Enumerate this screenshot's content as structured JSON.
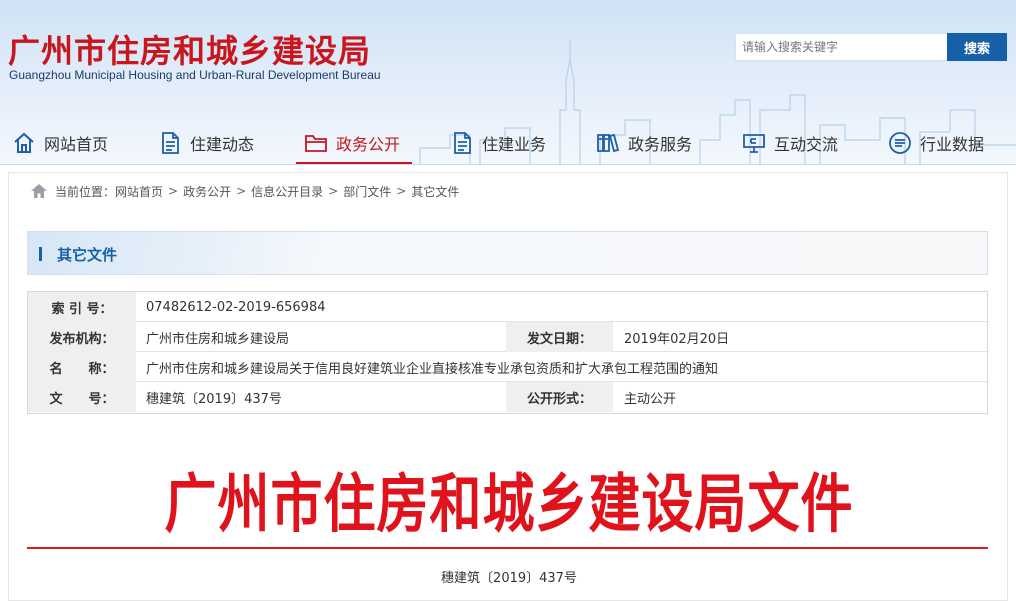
{
  "header": {
    "title": "广州市住房和城乡建设局",
    "subtitle": "Guangzhou Municipal Housing and Urban-Rural Development Bureau",
    "search": {
      "placeholder": "请输入搜索关键字",
      "button_label": "搜索"
    }
  },
  "nav": {
    "items": [
      {
        "label": "网站首页",
        "icon": "home-icon"
      },
      {
        "label": "住建动态",
        "icon": "document-icon"
      },
      {
        "label": "政务公开",
        "icon": "folder-icon",
        "active": true
      },
      {
        "label": "住建业务",
        "icon": "document-icon"
      },
      {
        "label": "政务服务",
        "icon": "books-icon"
      },
      {
        "label": "互动交流",
        "icon": "monitor-icon"
      },
      {
        "label": "行业数据",
        "icon": "chat-icon"
      }
    ]
  },
  "breadcrumb": {
    "prefix": "当前位置：",
    "items": [
      "网站首页",
      "政务公开",
      "信息公开目录",
      "部门文件",
      "其它文件"
    ],
    "separator": ">"
  },
  "section": {
    "title": "其它文件"
  },
  "meta": {
    "index_label": "索 引 号：",
    "index_value": "07482612-02-2019-656984",
    "publisher_label": "发布机构：",
    "publisher_value": "广州市住房和城乡建设局",
    "date_label": "发文日期：",
    "date_value": "2019年02月20日",
    "name_label": "名　　称：",
    "name_value": "广州市住房和城乡建设局关于信用良好建筑业企业直接核准专业承包资质和扩大承包工程范围的通知",
    "docno_label": "文　　号：",
    "docno_value": "穗建筑〔2019〕437号",
    "form_label": "公开形式：",
    "form_value": "主动公开"
  },
  "document": {
    "heading": "广州市住房和城乡建设局文件",
    "number": "穗建筑〔2019〕437号"
  },
  "colors": {
    "brand_red": "#c9161d",
    "doc_red": "#e0121b",
    "accent_blue": "#1660a9"
  }
}
